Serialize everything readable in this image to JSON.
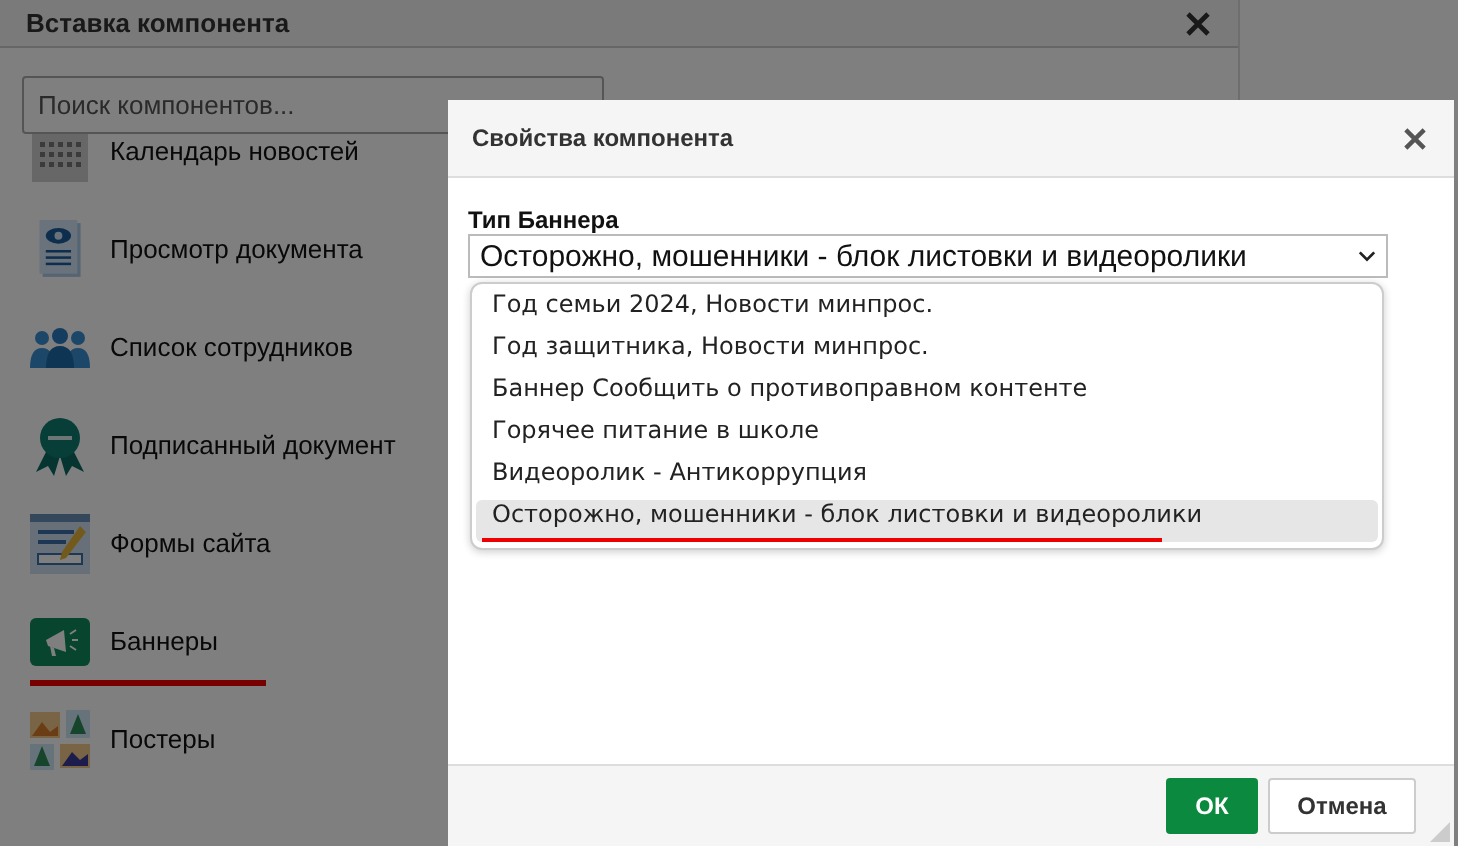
{
  "background_window": {
    "title": "Вставка компонента",
    "search": {
      "placeholder": "Поиск компонентов..."
    },
    "components": [
      {
        "label": "Календарь новостей",
        "underlined": false
      },
      {
        "label": "Просмотр документа",
        "underlined": false
      },
      {
        "label": "Список сотрудников",
        "underlined": false
      },
      {
        "label": "Подписанный документ",
        "underlined": false
      },
      {
        "label": "Формы сайта",
        "underlined": false
      },
      {
        "label": "Баннеры",
        "underlined": true
      },
      {
        "label": "Постеры",
        "underlined": false
      }
    ]
  },
  "dialog": {
    "title": "Свойства компонента",
    "field_label": "Тип Баннера",
    "value": "Осторожно, мошенники - блок листовки и видеоролики",
    "options": [
      {
        "label": "Год семьи 2024, Новости минпрос.",
        "selected": false,
        "underlined": false
      },
      {
        "label": "Год защитника, Новости минпрос.",
        "selected": false,
        "underlined": false
      },
      {
        "label": "Баннер Сообщить о противоправном контенте",
        "selected": false,
        "underlined": false
      },
      {
        "label": "Горячее питание в школе",
        "selected": false,
        "underlined": false
      },
      {
        "label": "Видеоролик - Антикоррупция",
        "selected": false,
        "underlined": false
      },
      {
        "label": "Осторожно, мошенники - блок листовки и видеоролики",
        "selected": true,
        "underlined": true
      }
    ],
    "buttons": [
      {
        "label": "ОК",
        "kind": "primary"
      },
      {
        "label": "Отмена",
        "kind": "secondary"
      }
    ]
  }
}
